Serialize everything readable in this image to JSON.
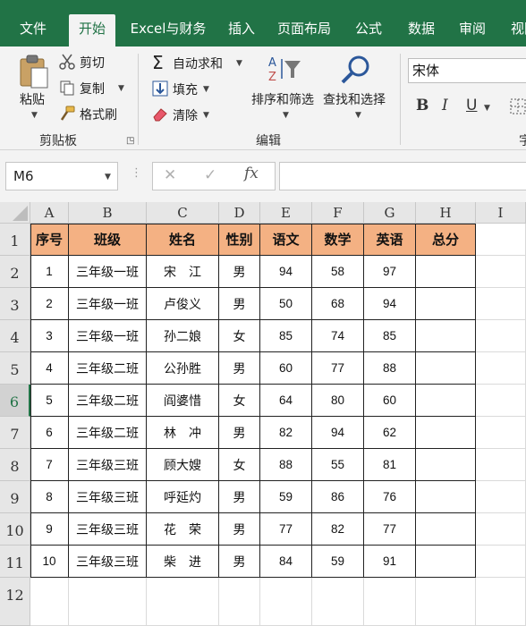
{
  "ribbon_tabs": [
    "文件",
    "开始",
    "Excel与财务",
    "插入",
    "页面布局",
    "公式",
    "数据",
    "审阅",
    "视图"
  ],
  "clipboard": {
    "paste": "粘贴",
    "cut": "剪切",
    "copy": "复制",
    "format_painter": "格式刷",
    "group": "剪贴板"
  },
  "editing": {
    "autosum": "自动求和",
    "fill": "填充",
    "clear": "清除",
    "sort_filter": "排序和筛选",
    "find_select": "查找和选择",
    "group": "编辑"
  },
  "font": {
    "name": "宋体",
    "bold": "B",
    "italic": "I",
    "underline": "U",
    "group_partial": "字"
  },
  "formula_bar": {
    "name_box": "M6",
    "cancel": "✕",
    "enter": "✓",
    "fx": "fx",
    "content": ""
  },
  "columns": [
    "A",
    "B",
    "C",
    "D",
    "E",
    "F",
    "G",
    "H",
    "I"
  ],
  "rows": [
    "1",
    "2",
    "3",
    "4",
    "5",
    "6",
    "7",
    "8",
    "9",
    "10",
    "11",
    "12"
  ],
  "table": {
    "headers": [
      "序号",
      "班级",
      "姓名",
      "性别",
      "语文",
      "数学",
      "英语",
      "总分"
    ],
    "rows": [
      [
        "1",
        "三年级一班",
        "宋　江",
        "男",
        "94",
        "58",
        "97",
        ""
      ],
      [
        "2",
        "三年级一班",
        "卢俊义",
        "男",
        "50",
        "68",
        "94",
        ""
      ],
      [
        "3",
        "三年级一班",
        "孙二娘",
        "女",
        "85",
        "74",
        "85",
        ""
      ],
      [
        "4",
        "三年级二班",
        "公孙胜",
        "男",
        "60",
        "77",
        "88",
        ""
      ],
      [
        "5",
        "三年级二班",
        "阎婆惜",
        "女",
        "64",
        "80",
        "60",
        ""
      ],
      [
        "6",
        "三年级二班",
        "林　冲",
        "男",
        "82",
        "94",
        "62",
        ""
      ],
      [
        "7",
        "三年级三班",
        "顾大嫂",
        "女",
        "88",
        "55",
        "81",
        ""
      ],
      [
        "8",
        "三年级三班",
        "呼延灼",
        "男",
        "59",
        "86",
        "76",
        ""
      ],
      [
        "9",
        "三年级三班",
        "花　荣",
        "男",
        "77",
        "82",
        "77",
        ""
      ],
      [
        "10",
        "三年级三班",
        "柴　进",
        "男",
        "84",
        "59",
        "91",
        ""
      ]
    ]
  },
  "colors": {
    "accent": "#217346",
    "header_fill": "#f4b183"
  }
}
